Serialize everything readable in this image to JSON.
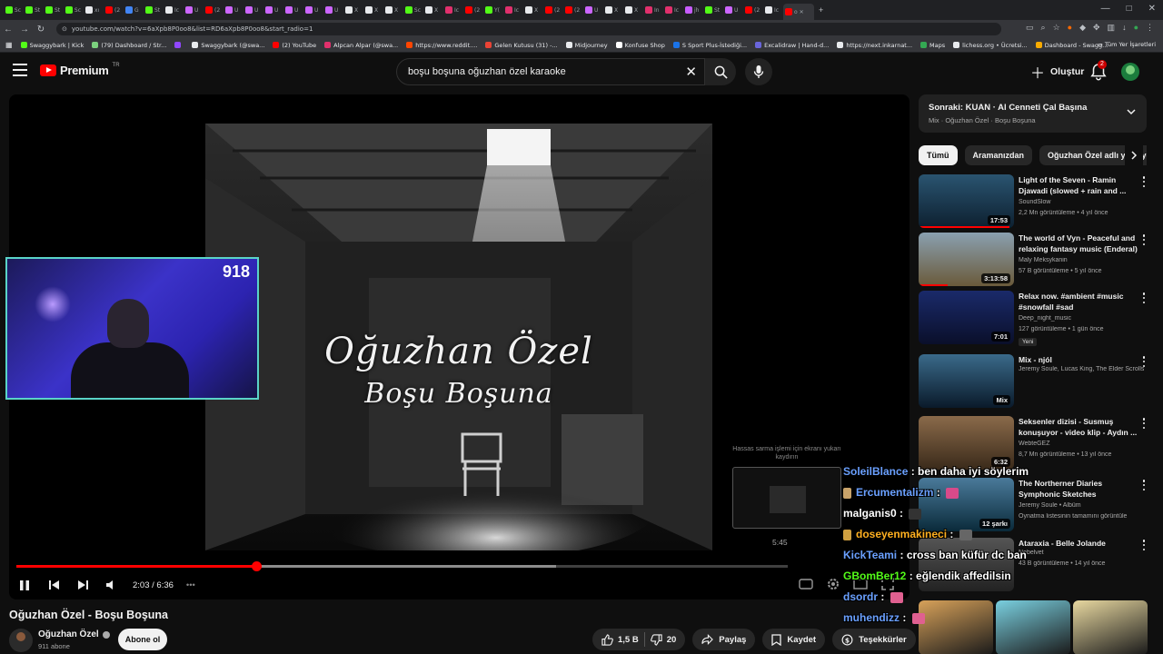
{
  "browser": {
    "tabs": [
      {
        "label": "Sc",
        "color": "#53fc18"
      },
      {
        "label": "St",
        "color": "#53fc18"
      },
      {
        "label": "St",
        "color": "#53fc18"
      },
      {
        "label": "Sc",
        "color": "#53fc18"
      },
      {
        "label": "xı",
        "color": "#e8eaed"
      },
      {
        "label": "(2",
        "color": "#ff0000"
      },
      {
        "label": "G",
        "color": "#4285f4"
      },
      {
        "label": "St",
        "color": "#53fc18"
      },
      {
        "label": "Ic",
        "color": "#e8eaed"
      },
      {
        "label": "U",
        "color": "#cc66ff"
      },
      {
        "label": "(2",
        "color": "#ff0000"
      },
      {
        "label": "U",
        "color": "#cc66ff"
      },
      {
        "label": "U",
        "color": "#cc66ff"
      },
      {
        "label": "U",
        "color": "#cc66ff"
      },
      {
        "label": "U",
        "color": "#cc66ff"
      },
      {
        "label": "U",
        "color": "#cc66ff"
      },
      {
        "label": "U",
        "color": "#cc66ff"
      },
      {
        "label": "X",
        "color": "#e8eaed"
      },
      {
        "label": "X",
        "color": "#e8eaed"
      },
      {
        "label": "X",
        "color": "#e8eaed"
      },
      {
        "label": "Sc",
        "color": "#53fc18"
      },
      {
        "label": "X",
        "color": "#e8eaed"
      },
      {
        "label": "Ic",
        "color": "#e1306c"
      },
      {
        "label": "(2",
        "color": "#ff0000"
      },
      {
        "label": "Y(",
        "color": "#53fc18"
      },
      {
        "label": "Ic",
        "color": "#e1306c"
      },
      {
        "label": "X",
        "color": "#e8eaed"
      },
      {
        "label": "(2",
        "color": "#ff0000"
      },
      {
        "label": "(2",
        "color": "#ff0000"
      },
      {
        "label": "U",
        "color": "#cc66ff"
      },
      {
        "label": "X",
        "color": "#e8eaed"
      },
      {
        "label": "X",
        "color": "#e8eaed"
      },
      {
        "label": "In",
        "color": "#e1306c"
      },
      {
        "label": "Ic",
        "color": "#e1306c"
      },
      {
        "label": "jh",
        "color": "#c75cff"
      },
      {
        "label": "St",
        "color": "#53fc18"
      },
      {
        "label": "U",
        "color": "#cc66ff"
      },
      {
        "label": "(2",
        "color": "#ff0000"
      },
      {
        "label": "Ic",
        "color": "#e8eaed"
      }
    ],
    "active_tab": "o",
    "url": "youtube.com/watch?v=6aXpb8P0oo8&list=RD6aXpb8P0oo8&start_radio=1",
    "bookmarks": [
      {
        "label": "Swaggybark | Kick",
        "color": "#53fc18"
      },
      {
        "label": "(79) Dashboard / Str...",
        "color": "#7bd07e"
      },
      {
        "label": "",
        "color": "#9147ff"
      },
      {
        "label": "Swaggybark (@swa...",
        "color": "#e8eaed"
      },
      {
        "label": "(2) YouTube",
        "color": "#ff0000"
      },
      {
        "label": "Alpcan Alpar (@swa...",
        "color": "#e1306c"
      },
      {
        "label": "https://www.reddit....",
        "color": "#ff4500"
      },
      {
        "label": "Gelen Kutusu (31) -...",
        "color": "#ea4335"
      },
      {
        "label": "Midjourney",
        "color": "#e8eaed"
      },
      {
        "label": "Konfuse Shop",
        "color": "#ffffff"
      },
      {
        "label": "S Sport Plus-İstediği...",
        "color": "#1a73e8"
      },
      {
        "label": "Excalidraw | Hand-d...",
        "color": "#6965db"
      },
      {
        "label": "https://next.inkarnat...",
        "color": "#e8eaed"
      },
      {
        "label": "Maps",
        "color": "#34a853"
      },
      {
        "label": "lichess.org • Ücretsi...",
        "color": "#e8eaed"
      },
      {
        "label": "Dashboard - Swagg...",
        "color": "#f9ab00"
      }
    ],
    "bookmarks_all": "Tüm Yer İşaretleri"
  },
  "masthead": {
    "logo_word": "Premium",
    "region": "TR",
    "search_query": "boşu boşuna oğuzhan özel karaoke",
    "create_label": "Oluştur",
    "notif_count": "2"
  },
  "player": {
    "video_text_line1": "Oğuzhan Özel",
    "video_text_line2": "Boşu Boşuna",
    "webcam_count": "918",
    "time": "2:03 / 6:36",
    "progress_fraction": 0.311,
    "buffer_fraction": 0.7,
    "preview_hint": "Hassas sarma işlemi için ekranı yukarı kaydırın",
    "preview_time": "5:45"
  },
  "video": {
    "title": "Oğuzhan Özel - Boşu Boşuna",
    "channel": "Oğuzhan Özel",
    "subscribers": "911 abone",
    "subscribe_label": "Abone ol",
    "likes": "1,5 B",
    "dislikes": "20",
    "share_label": "Paylaş",
    "save_label": "Kaydet",
    "thanks_label": "Teşekkürler"
  },
  "sidebar": {
    "next_title": "Sonraki: KUAN · Al Cenneti Çal Başına",
    "next_sub": "Mix · Oğuzhan Özel · Boşu Boşuna",
    "chips": [
      "Tümü",
      "Aramanızdan",
      "Oğuzhan Özel adlı yükleyen"
    ],
    "recommendations": [
      {
        "title": "Light of the Seven - Ramin Djawadi (slowed + rain and ...",
        "channel": "SoundSlow",
        "meta": "2,2 Mn görüntüleme • 4 yıl önce",
        "duration": "17:53",
        "thumb_top": "#2a5470",
        "thumb_bottom": "#0d2030",
        "watched": 0.95
      },
      {
        "title": "The world of Vyn - Peaceful and relaxing fantasy music (Enderal)",
        "channel": "Maly Meksykanin",
        "meta": "57 B görüntüleme • 5 yıl önce",
        "duration": "3:13:58",
        "thumb_top": "#8aa0b0",
        "thumb_bottom": "#6a5a3a",
        "watched": 0.3
      },
      {
        "title": "Relax now. #ambient #music #snowfall #sad",
        "channel": "Deep_night_music",
        "meta": "127 görüntüleme • 1 gün önce",
        "duration": "7:01",
        "badge": "Yeni",
        "thumb_top": "#1a2a6a",
        "thumb_bottom": "#0a0f2a",
        "watched": 0
      },
      {
        "title": "Mix - njól",
        "channel": "Jeremy Soule, Lucas King, The Elder Scrolls...",
        "meta": "",
        "duration": "Mix",
        "thumb_top": "#3a6a8a",
        "thumb_bottom": "#0a1a2a",
        "watched": 0
      },
      {
        "title": "Seksenler dizisi - Susmuş konuşuyor - video klip - Aydın ...",
        "channel": "WebteGEZ",
        "meta": "8,7 Mn görüntüleme • 13 yıl önce",
        "duration": "6:32",
        "thumb_top": "#8a6a4a",
        "thumb_bottom": "#3a2a1a",
        "watched": 0
      },
      {
        "title": "The Northerner Diaries Symphonic Sketches",
        "channel": "Jeremy Soule • Albüm",
        "meta": "Oynatma listesinin tamamını görüntüle",
        "duration": "12 şarkı",
        "thumb_top": "#4a7a9a",
        "thumb_bottom": "#0a2a3a",
        "watched": 0
      },
      {
        "title": "Ataraxia - Belle Jolande",
        "channel": "Nebelvet",
        "meta": "43 B görüntüleme • 14 yıl önce",
        "duration": "",
        "thumb_top": "#555555",
        "thumb_bottom": "#222222",
        "watched": 0
      }
    ],
    "shorts_colors": [
      "#d8a25a",
      "#7ad0e0",
      "#e8d8a0"
    ]
  },
  "chat": [
    {
      "user": "SoleilBlance",
      "color": "#6aa0ff",
      "text": "ben daha iyi söylerim",
      "emote": ""
    },
    {
      "user": "Ercumentalizm",
      "color": "#6aa0ff",
      "text": "",
      "emote": "#d84a8a"
    },
    {
      "user": "malganis0",
      "color": "#ffffff",
      "text": "",
      "emote": "#333333"
    },
    {
      "user": "doseyenmakineci",
      "color": "#ffb020",
      "text": "",
      "emote": "#666666"
    },
    {
      "user": "KickTeami",
      "color": "#6aa0ff",
      "text": "cross ban küfür dc ban",
      "emote": ""
    },
    {
      "user": "GBomBer12",
      "color": "#53fc18",
      "text": "eğlendik affedilsin",
      "emote": ""
    },
    {
      "user": "dsordr",
      "color": "#6aa0ff",
      "text": "",
      "emote": "#e06090"
    },
    {
      "user": "muhendizz",
      "color": "#6aa0ff",
      "text": "",
      "emote": "#e06090"
    }
  ]
}
